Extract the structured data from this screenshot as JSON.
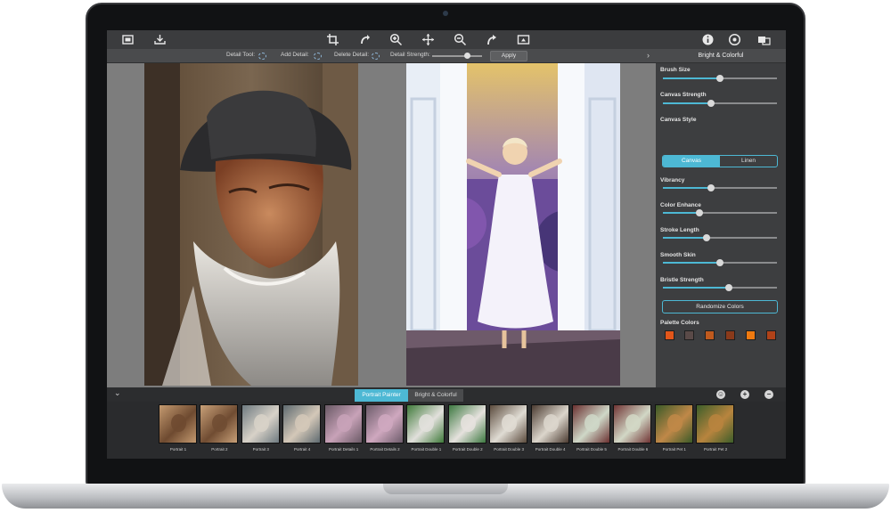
{
  "toolbar": {
    "left_icons": [
      "open-image-icon",
      "save-image-icon"
    ],
    "center_icons": [
      "crop-icon",
      "undo-icon",
      "zoom-in-icon",
      "pan-icon",
      "zoom-out-icon",
      "redo-icon",
      "compare-icon"
    ],
    "right_icons": [
      "info-icon",
      "settings-icon",
      "share-icon"
    ]
  },
  "options": {
    "detail_tool_label": "Detail Tool:",
    "add_detail_label": "Add Detail:",
    "delete_detail_label": "Delete Detail:",
    "detail_strength_label": "Detail Strength:",
    "detail_strength_value": 0.7,
    "apply_label": "Apply"
  },
  "panel": {
    "title": "Bright & Colorful",
    "sliders": [
      {
        "label": "Brush Size",
        "value": 0.5
      },
      {
        "label": "Canvas Strength",
        "value": 0.42
      }
    ],
    "canvas_style_label": "Canvas Style",
    "canvas_style_options": [
      "Canvas",
      "Linen"
    ],
    "canvas_style_selected": "Canvas",
    "sliders2": [
      {
        "label": "Vibrancy",
        "value": 0.42
      },
      {
        "label": "Color Enhance",
        "value": 0.32
      },
      {
        "label": "Stroke Length",
        "value": 0.38
      },
      {
        "label": "Smooth Skin",
        "value": 0.5
      },
      {
        "label": "Bristle Strength",
        "value": 0.58
      }
    ],
    "randomize_label": "Randomize Colors",
    "palette_label": "Palette Colors",
    "palette_colors": [
      "#e2561a",
      "#5a4a48",
      "#c05a1e",
      "#8a3a1a",
      "#f07a10",
      "#b04218"
    ]
  },
  "bottom": {
    "tabs": [
      "Portrait Painter",
      "Bright & Colorful"
    ],
    "active_tab": "Portrait Painter",
    "thumbnails": [
      "Portrait 1",
      "Portrait 2",
      "Portrait 3",
      "Portrait 4",
      "Portrait Details 1",
      "Portrait Details 2",
      "Portrait Double 1",
      "Portrait Double 2",
      "Portrait Double 3",
      "Portrait Double 4",
      "Portrait Double 5",
      "Portrait Double 6",
      "Portrait Pet 1",
      "Portrait Pet 2"
    ]
  }
}
